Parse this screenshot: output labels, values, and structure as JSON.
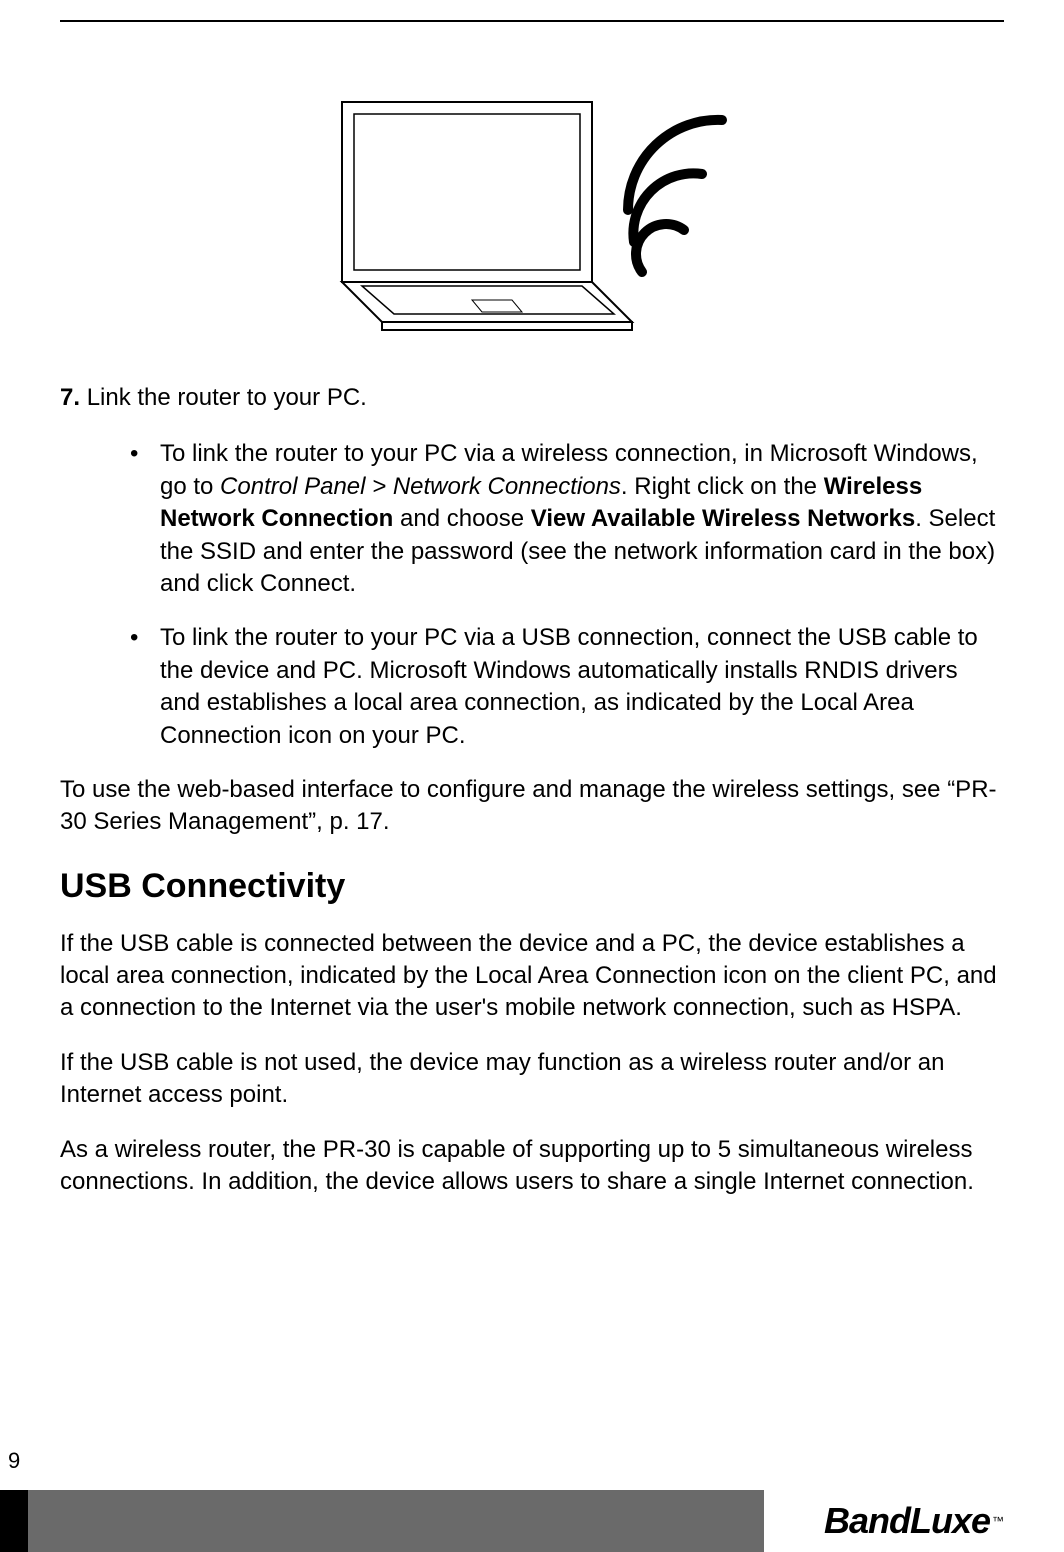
{
  "step": {
    "number": "7.",
    "text": "Link the router to your PC."
  },
  "bullets": [
    {
      "pre": "To link the router to your PC via a wireless connection, in Microsoft Windows, go to ",
      "italic": "Control Panel > Network Connections",
      "mid1": ". Right click on the ",
      "bold1": "Wireless Network Connection",
      "mid2": " and choose ",
      "bold2": "View Available Wireless Networks",
      "post": ". Select the SSID and enter the password (see the network information card in the box) and click Connect."
    },
    {
      "plain": "To link the router to your PC via a USB connection, connect the USB cable to the device and PC. Microsoft Windows automatically installs RNDIS drivers and establishes a local area connection, as indicated by the Local Area Connection icon on your PC."
    }
  ],
  "para_after_bullets": "To use the web-based interface to configure and manage the wireless settings, see “PR-30 Series Management”, p. 17.",
  "section_heading": "USB Connectivity",
  "usb_paras": [
    "If the USB cable is connected between the device and a PC, the device establishes a local area connection, indicated by the Local Area Connection icon on the client PC, and a connection to the Internet via the user's mobile network connection, such as HSPA.",
    "If the USB cable is not used, the device may function as a wireless router and/or an Internet access point.",
    "As a wireless router, the PR-30 is capable of supporting up to 5 simultaneous wireless connections. In addition, the device allows users to share a single Internet connection."
  ],
  "page_number": "9",
  "logo": {
    "brand": "BandLuxe",
    "tm": "™"
  }
}
